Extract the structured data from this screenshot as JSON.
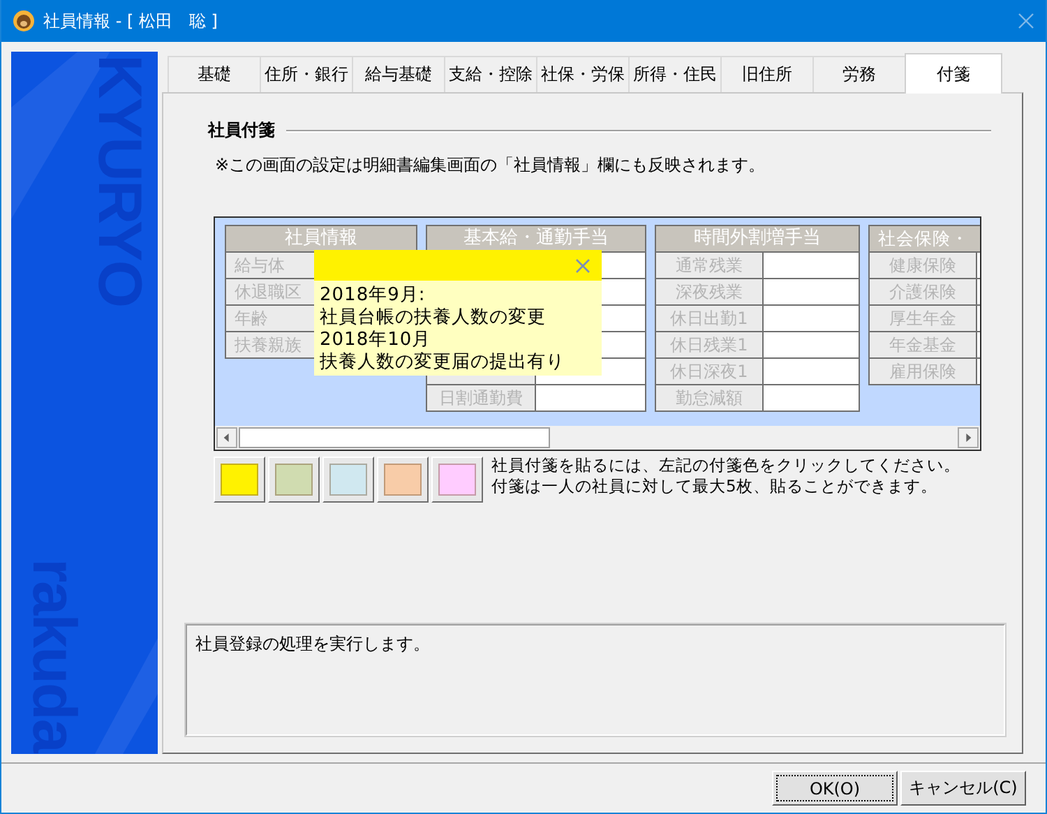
{
  "window": {
    "title": "社員情報 - [ 松田　聡 ]"
  },
  "sidebar": {
    "logo_texts": [
      "KYURYO",
      "rakuda"
    ]
  },
  "tabs": [
    {
      "label": "基礎",
      "selected": false
    },
    {
      "label": "住所・銀行",
      "selected": false
    },
    {
      "label": "給与基礎",
      "selected": false
    },
    {
      "label": "支給・控除",
      "selected": false
    },
    {
      "label": "社保・労保",
      "selected": false
    },
    {
      "label": "所得・住民",
      "selected": false
    },
    {
      "label": "旧住所",
      "selected": false
    },
    {
      "label": "労務",
      "selected": false
    },
    {
      "label": "付箋",
      "selected": true
    }
  ],
  "section": {
    "title": "社員付箋",
    "note": "※この画面の設定は明細書編集画面の「社員情報」欄にも反映されます。"
  },
  "grid": {
    "tables": [
      {
        "header": "社員情報",
        "rows": [
          {
            "label": "給与体"
          },
          {
            "label": "休退職区"
          },
          {
            "label": "年齢"
          },
          {
            "label": "扶養親族"
          }
        ]
      },
      {
        "header": "基本給・通勤手当",
        "kind": "scrolled",
        "rows": [
          {
            "covered": true
          },
          {
            "label": "日割通勤費"
          }
        ]
      },
      {
        "header": "時間外割増手当",
        "rows": [
          {
            "label": "通常残業"
          },
          {
            "label": "深夜残業"
          },
          {
            "label": "休日出勤1"
          },
          {
            "label": "休日残業1"
          },
          {
            "label": "休日深夜1"
          },
          {
            "label": "勤怠減額"
          }
        ]
      },
      {
        "header": "社会保険・",
        "rows": [
          {
            "label": "健康保険"
          },
          {
            "label": "介護保険"
          },
          {
            "label": "厚生年金"
          },
          {
            "label": "年金基金"
          },
          {
            "label": "雇用保険"
          }
        ]
      }
    ]
  },
  "note_popup": {
    "color": "#fff200",
    "lines": [
      "2018年9月:",
      "社員台帳の扶養人数の変更",
      "2018年10月",
      "扶養人数の変更届の提出有り"
    ]
  },
  "swatches": [
    {
      "color": "#fff200"
    },
    {
      "color": "#d0dcb0"
    },
    {
      "color": "#d0e8f0"
    },
    {
      "color": "#f8cca8"
    },
    {
      "color": "#ffccff"
    }
  ],
  "swatch_help": [
    "社員付箋を貼るには、左記の付箋色をクリックしてください。",
    "付箋は一人の社員に対して最大5枚、貼ることができます。"
  ],
  "message": "社員登録の処理を実行します。",
  "buttons": [
    {
      "label": "OK(O)",
      "focused": true
    },
    {
      "label": "キャンセル(C)",
      "focused": false
    }
  ]
}
